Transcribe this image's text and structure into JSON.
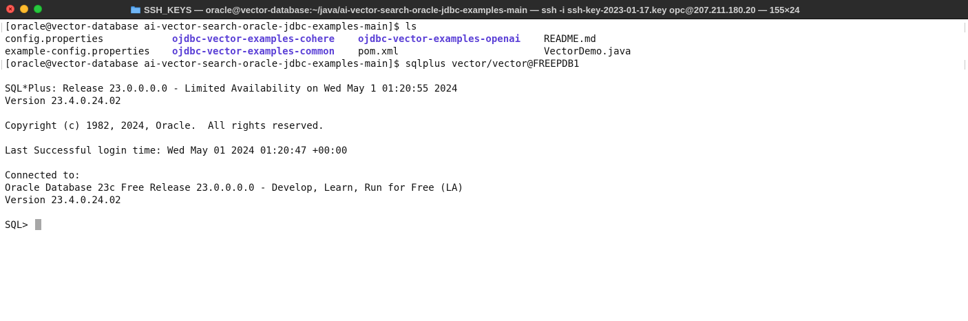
{
  "window": {
    "title": "SSH_KEYS — oracle@vector-database:~/java/ai-vector-search-oracle-jdbc-examples-main — ssh -i ssh-key-2023-01-17.key opc@207.211.180.20 — 155×24",
    "folder_icon": "folder-icon",
    "colors": {
      "titlebar": "#2b2b2b",
      "close": "#ff5f57",
      "minimize": "#febc2e",
      "zoom": "#28c840",
      "directory": "#5a3fd6"
    }
  },
  "terminal": {
    "prompt_ls": "[oracle@vector-database ai-vector-search-oracle-jdbc-examples-main]$ ls",
    "ls_rows": [
      [
        "config.properties",
        "ojdbc-vector-examples-cohere",
        "ojdbc-vector-examples-openai",
        "README.md"
      ],
      [
        "example-config.properties",
        "ojdbc-vector-examples-common",
        "pom.xml",
        "VectorDemo.java"
      ]
    ],
    "prompt_sqlplus": "[oracle@vector-database ai-vector-search-oracle-jdbc-examples-main]$ sqlplus vector/vector@FREEPDB1",
    "banner": "SQL*Plus: Release 23.0.0.0.0 - Limited Availability on Wed May 1 01:20:55 2024",
    "version1": "Version 23.4.0.24.02",
    "copyright": "Copyright (c) 1982, 2024, Oracle.  All rights reserved.",
    "last_login": "Last Successful login time: Wed May 01 2024 01:20:47 +00:00",
    "connected": "Connected to:",
    "db_info": "Oracle Database 23c Free Release 23.0.0.0.0 - Develop, Learn, Run for Free (LA)",
    "version2": "Version 23.4.0.24.02",
    "sql_prompt": "SQL> "
  }
}
